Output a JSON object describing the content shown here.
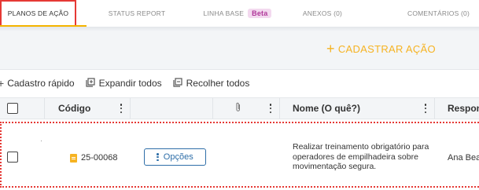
{
  "tabs": [
    {
      "label": "PLANOS DE AÇÃO",
      "active": true
    },
    {
      "label": "STATUS REPORT"
    },
    {
      "label": "LINHA BASE",
      "badge": "Beta"
    },
    {
      "label": "ANEXOS (0)"
    },
    {
      "label": "COMENTÁRIOS (0)"
    }
  ],
  "actions": {
    "cadastrar_label": "CADASTRAR AÇÃO"
  },
  "toolbar": {
    "cadastro_rapido": "Cadastro rápido",
    "expandir_todos": "Expandir todos",
    "recolher_todos": "Recolher todos"
  },
  "table": {
    "columns": {
      "codigo": "Código",
      "nome": "Nome (O quê?)",
      "responsavel": "Respons"
    },
    "rows": [
      {
        "codigo": "25-00068",
        "opcoes_label": "Opções",
        "nome": "Realizar treinamento obrigatório para operadores de empilhadeira sobre movimentação segura.",
        "responsavel": "Ana Beat"
      }
    ]
  },
  "colors": {
    "accent": "#f6b322",
    "primary": "#2e6ea8",
    "highlight": "#e53935",
    "badge_bg": "#f3d9ef",
    "badge_text": "#b0389a"
  }
}
